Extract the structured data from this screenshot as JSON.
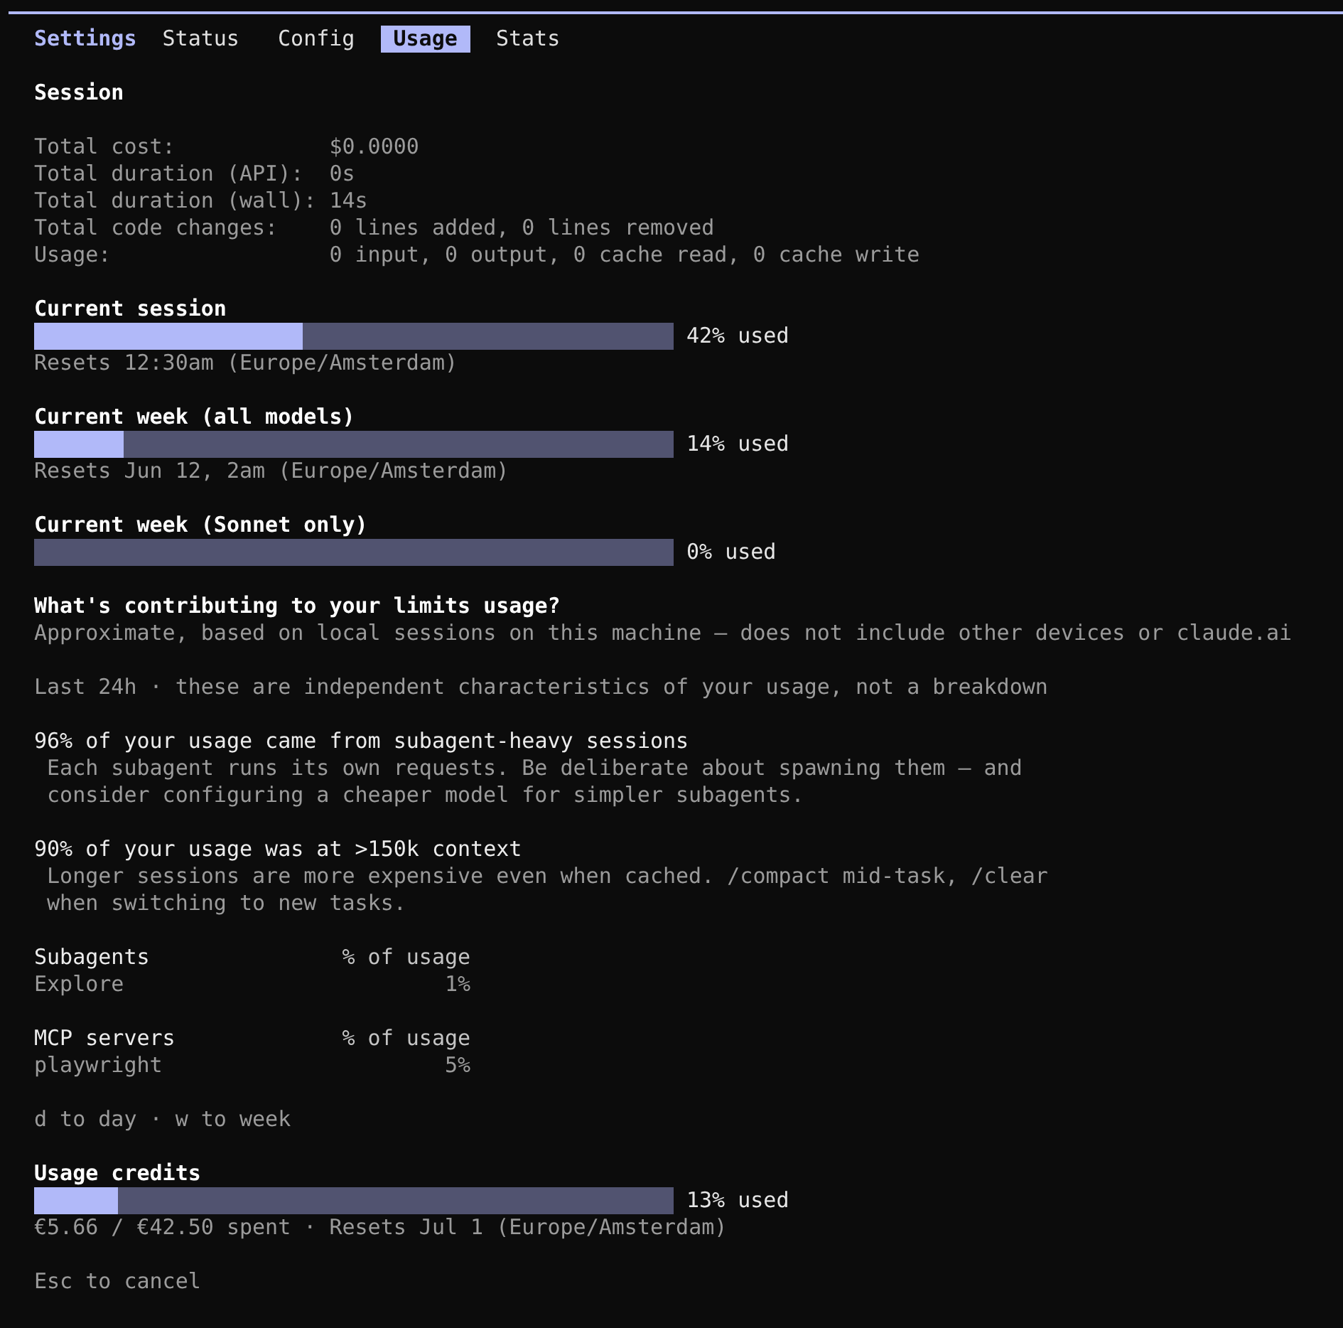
{
  "tabs": {
    "title": "Settings",
    "items": [
      {
        "label": "Status",
        "selected": false
      },
      {
        "label": "Config",
        "selected": false
      },
      {
        "label": "Usage",
        "selected": true
      },
      {
        "label": "Stats",
        "selected": false
      }
    ]
  },
  "session": {
    "heading": "Session",
    "rows": [
      {
        "label": "Total cost:",
        "value": "$0.0000"
      },
      {
        "label": "Total duration (API):",
        "value": "0s"
      },
      {
        "label": "Total duration (wall):",
        "value": "14s"
      },
      {
        "label": "Total code changes:",
        "value": "0 lines added, 0 lines removed"
      },
      {
        "label": "Usage:",
        "value": "0 input, 0 output, 0 cache read, 0 cache write"
      }
    ]
  },
  "meters": [
    {
      "title": "Current session",
      "level": 0.42,
      "reading": "42% used",
      "note": "Resets 12:30am (Europe/Amsterdam)"
    },
    {
      "title": "Current week (all models)",
      "level": 0.14,
      "reading": "14% used",
      "note": "Resets Jun 12, 2am (Europe/Amsterdam)"
    },
    {
      "title": "Current week (Sonnet only)",
      "level": 0,
      "reading": "0% used"
    }
  ],
  "contributing": {
    "heading": "What's contributing to your limits usage?",
    "subtitle": "Approximate, based on local sessions on this machine — does not include other devices or claude.ai",
    "period_note": "Last 24h · these are independent characteristics of your usage, not a breakdown",
    "findings": [
      {
        "title": "96% of your usage came from subagent-heavy sessions",
        "detail": "Each subagent runs its own requests. Be deliberate about spawning them — and consider configuring a cheaper model for simpler subagents."
      },
      {
        "title": "90% of your usage was at >150k context",
        "detail": "Longer sessions are more expensive even when cached. /compact mid-task, /clear when switching to new tasks."
      }
    ]
  },
  "tables": [
    {
      "columns": [
        "Subagents",
        "% of usage"
      ],
      "rows": [
        [
          "Explore",
          "1%"
        ]
      ]
    },
    {
      "columns": [
        "MCP servers",
        "% of usage"
      ],
      "rows": [
        [
          "playwright",
          "5%"
        ]
      ]
    }
  ],
  "hint": "d to day · w to week",
  "credits": {
    "title": "Usage credits",
    "level": 0.13,
    "reading": "13% used",
    "note": "€5.66 / €42.50 spent · Resets Jul 1 (Europe/Amsterdam)"
  },
  "footer": "Esc to cancel"
}
